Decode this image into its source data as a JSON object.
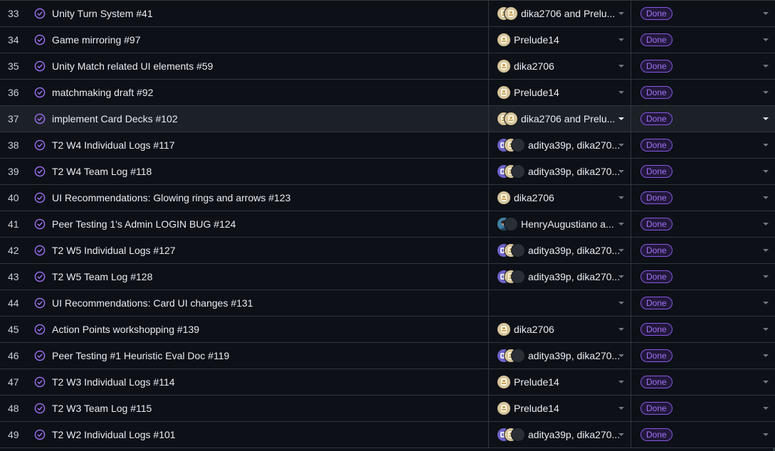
{
  "colors": {
    "background": "#0d1117",
    "row_highlight": "#1c2128",
    "border": "#30363d",
    "done_badge_text": "#a371f7",
    "done_badge_border": "#8957e5",
    "status_icon": "#a371f7"
  },
  "rows": [
    {
      "number": "33",
      "title": "Unity Turn System  #41",
      "assignees": "dika2706 and Prelu...",
      "avatars": [
        "gold",
        "gold"
      ],
      "status": "Done",
      "highlighted": false
    },
    {
      "number": "34",
      "title": "Game mirroring  #97",
      "assignees": "Prelude14",
      "avatars": [
        "gold"
      ],
      "status": "Done",
      "highlighted": false
    },
    {
      "number": "35",
      "title": "Unity Match related UI elements  #59",
      "assignees": "dika2706",
      "avatars": [
        "gold"
      ],
      "status": "Done",
      "highlighted": false
    },
    {
      "number": "36",
      "title": "matchmaking draft  #92",
      "assignees": "Prelude14",
      "avatars": [
        "gold"
      ],
      "status": "Done",
      "highlighted": false
    },
    {
      "number": "37",
      "title": "implement Card Decks  #102",
      "assignees": "dika2706 and Prelu...",
      "avatars": [
        "gold",
        "gold"
      ],
      "status": "Done",
      "highlighted": true
    },
    {
      "number": "38",
      "title": "T2 W4 Individual Logs  #117",
      "assignees": "aditya39p, dika270...",
      "avatars": [
        "purple",
        "gold",
        "dark"
      ],
      "status": "Done",
      "highlighted": false
    },
    {
      "number": "39",
      "title": "T2 W4 Team Log  #118",
      "assignees": "aditya39p, dika270...",
      "avatars": [
        "purple",
        "gold",
        "dark"
      ],
      "status": "Done",
      "highlighted": false
    },
    {
      "number": "40",
      "title": "UI Recommendations: Glowing rings and arrows  #123",
      "assignees": "dika2706",
      "avatars": [
        "gold"
      ],
      "status": "Done",
      "highlighted": false
    },
    {
      "number": "41",
      "title": "Peer Testing 1's Admin LOGIN BUG  #124",
      "assignees": "HenryAugustiano a...",
      "avatars": [
        "photo",
        "dark"
      ],
      "status": "Done",
      "highlighted": false
    },
    {
      "number": "42",
      "title": "T2 W5 Individual Logs  #127",
      "assignees": "aditya39p, dika270...",
      "avatars": [
        "purple",
        "gold",
        "dark"
      ],
      "status": "Done",
      "highlighted": false
    },
    {
      "number": "43",
      "title": "T2 W5 Team Log  #128",
      "assignees": "aditya39p, dika270...",
      "avatars": [
        "purple",
        "gold",
        "dark"
      ],
      "status": "Done",
      "highlighted": false
    },
    {
      "number": "44",
      "title": "UI Recommendations: Card UI changes  #131",
      "assignees": "",
      "avatars": [],
      "status": "Done",
      "highlighted": false
    },
    {
      "number": "45",
      "title": "Action Points workshopping  #139",
      "assignees": "dika2706",
      "avatars": [
        "gold"
      ],
      "status": "Done",
      "highlighted": false
    },
    {
      "number": "46",
      "title": "Peer Testing #1 Heuristic Eval Doc  #119",
      "assignees": "aditya39p, dika270...",
      "avatars": [
        "purple",
        "gold",
        "dark"
      ],
      "status": "Done",
      "highlighted": false
    },
    {
      "number": "47",
      "title": "T2 W3 Individual Logs  #114",
      "assignees": "Prelude14",
      "avatars": [
        "gold"
      ],
      "status": "Done",
      "highlighted": false
    },
    {
      "number": "48",
      "title": "T2 W3 Team Log  #115",
      "assignees": "Prelude14",
      "avatars": [
        "gold"
      ],
      "status": "Done",
      "highlighted": false
    },
    {
      "number": "49",
      "title": "T2 W2 Individual Logs  #101",
      "assignees": "aditya39p, dika270...",
      "avatars": [
        "purple",
        "gold",
        "dark"
      ],
      "status": "Done",
      "highlighted": false
    }
  ]
}
